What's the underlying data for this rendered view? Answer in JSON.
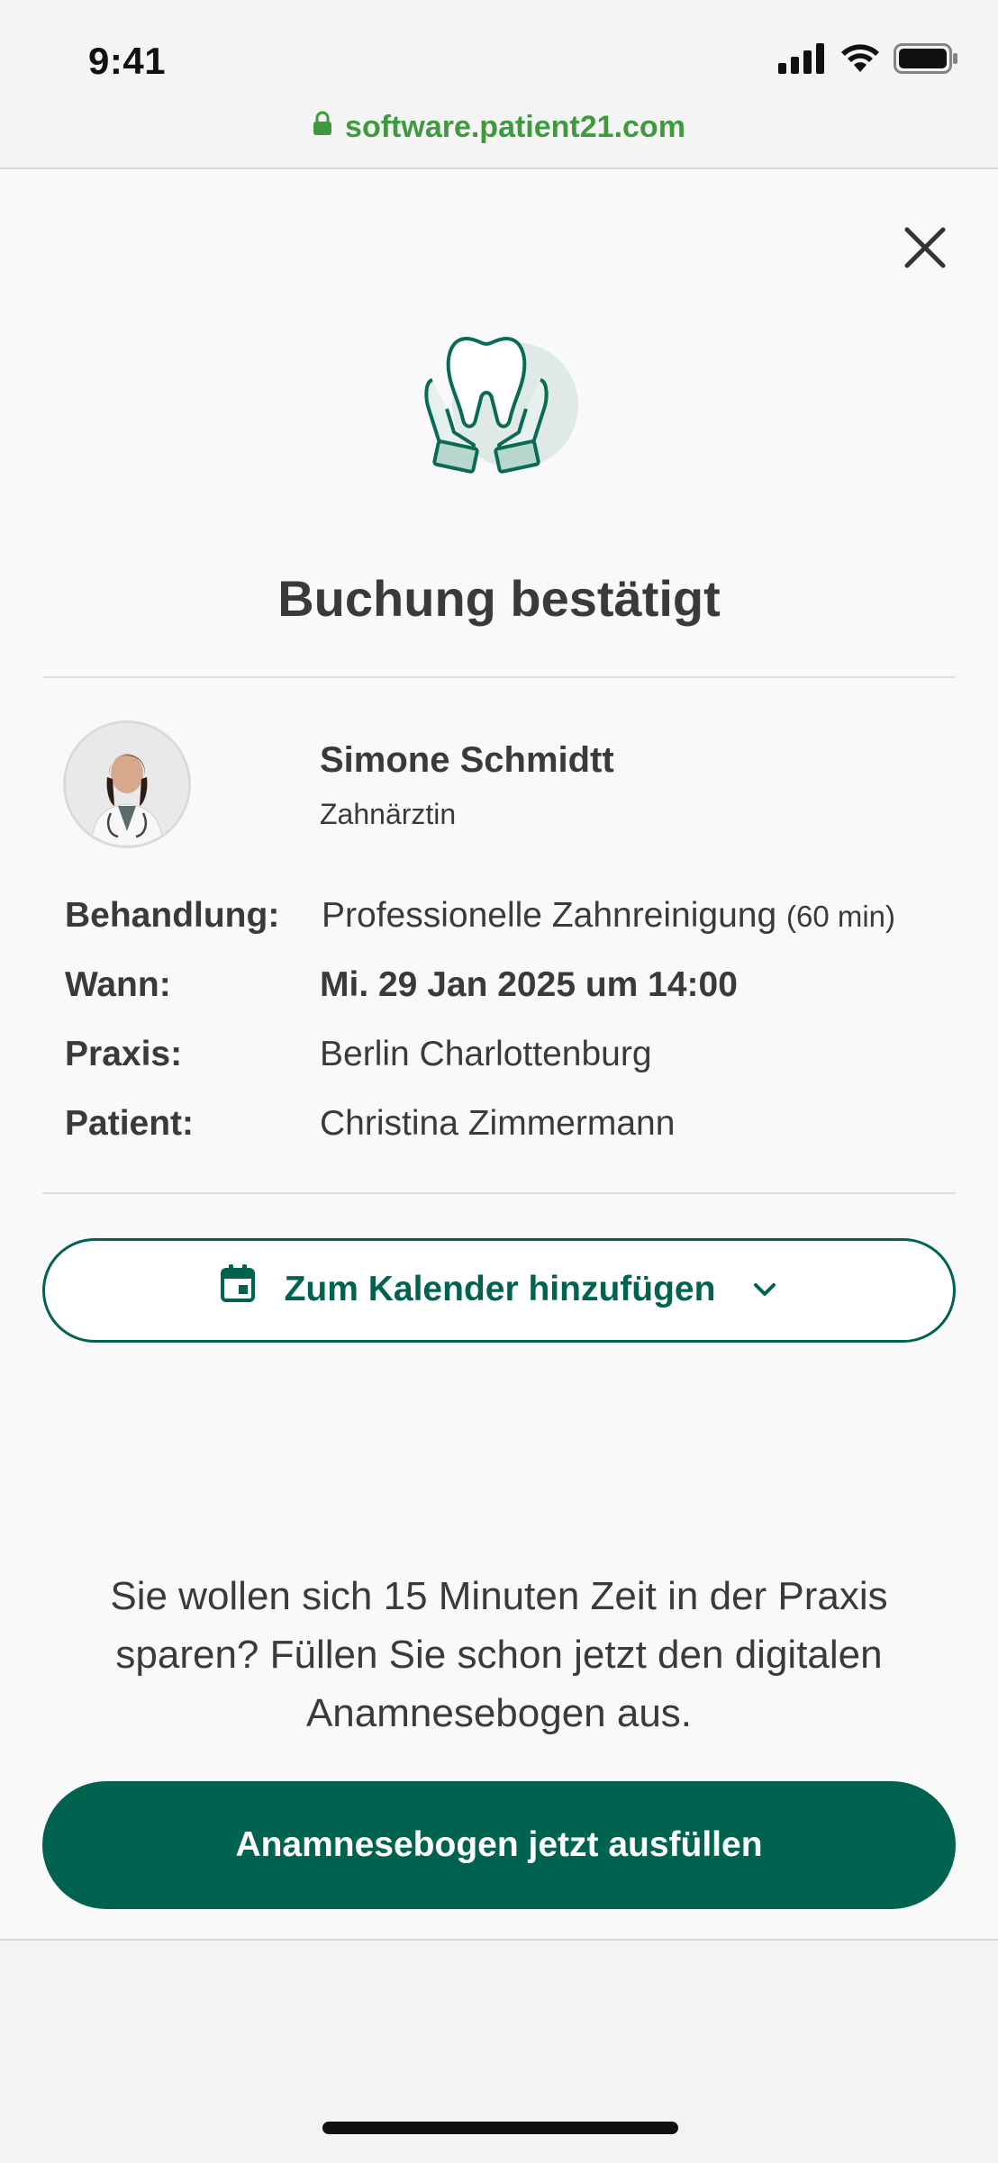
{
  "status_bar": {
    "time": "9:41"
  },
  "browser": {
    "url": "software.patient21.com"
  },
  "confirmation": {
    "title": "Buchung bestätigt"
  },
  "doctor": {
    "name": "Simone Schmidtt",
    "role": "Zahnärztin"
  },
  "details": {
    "treatment_label": "Behandlung:",
    "treatment_value": "Professionelle Zahnreinigung",
    "treatment_duration": "(60 min)",
    "when_label": "Wann:",
    "when_value": "Mi. 29 Jan 2025 um 14:00",
    "practice_label": "Praxis:",
    "practice_value": "Berlin Charlottenburg",
    "patient_label": "Patient:",
    "patient_value": "Christina Zimmermann"
  },
  "calendar_button": {
    "label": "Zum Kalender hinzufügen"
  },
  "promo_text": "Sie wollen sich 15 Minuten Zeit in der Praxis sparen? Füllen Sie schon jetzt den digitalen Anamnesebogen aus.",
  "cta_button": {
    "label": "Anamnesebogen jetzt ausfüllen"
  },
  "colors": {
    "primary": "#00634f",
    "url_green": "#3f9a3f",
    "text": "#3a3a3a"
  },
  "icons": [
    "lock-icon",
    "close-icon",
    "tooth-hands-icon",
    "calendar-icon",
    "chevron-down-icon",
    "signal-icon",
    "wifi-icon",
    "battery-icon"
  ]
}
